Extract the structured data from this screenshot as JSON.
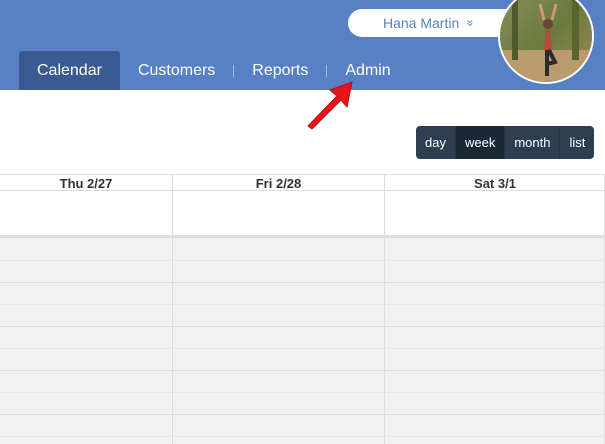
{
  "user": {
    "name": "Hana Martin",
    "chevron": "»",
    "avatar_icon": "user-photo"
  },
  "nav": {
    "tabs": [
      {
        "label": "Calendar",
        "active": true
      },
      {
        "label": "Customers",
        "active": false
      },
      {
        "label": "Reports",
        "active": false
      },
      {
        "label": "Admin",
        "active": false
      }
    ]
  },
  "view_buttons": [
    {
      "label": "day",
      "active": false
    },
    {
      "label": "week",
      "active": true
    },
    {
      "label": "month",
      "active": false
    },
    {
      "label": "list",
      "active": false
    }
  ],
  "calendar": {
    "columns": [
      "Thu 2/27",
      "Fri 2/28",
      "Sat 3/1"
    ]
  },
  "colors": {
    "header": "#5781c4",
    "active_tab": "#3b5a91",
    "annotation_arrow": "#e8141b",
    "view_bar": "#2c3e50"
  }
}
